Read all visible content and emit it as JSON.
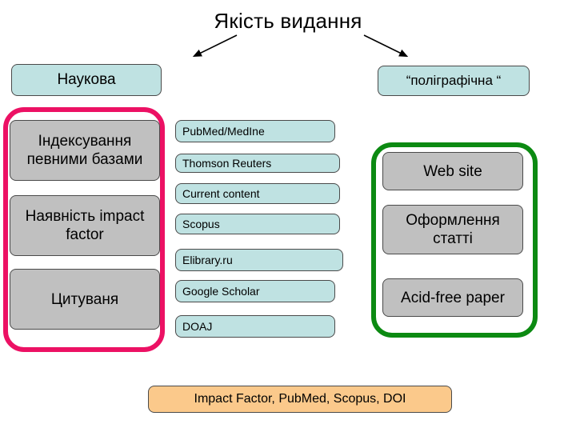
{
  "slide": {
    "title": "Якість видання",
    "background_color": "#ffffff"
  },
  "colors": {
    "cyan_box": "#bfe2e2",
    "gray_box": "#c0c0c0",
    "peach_box": "#fbc98b",
    "pink_frame": "#ec1164",
    "green_frame": "#0c8a12",
    "text": "#000000"
  },
  "branches": {
    "left": {
      "heading": "Наукова",
      "frame_color": "#ec1164",
      "items": [
        "Індексування певними базами",
        "Наявність impact factor",
        "Цитуваня"
      ]
    },
    "right": {
      "heading": "“поліграфічна “",
      "frame_color": "#0c8a12",
      "items": [
        "Web site",
        "Оформлення статті",
        "Acid-free paper"
      ]
    }
  },
  "databases": [
    "PubMed/MedIne",
    "Thomson Reuters",
    "Current content",
    "Scopus",
    "Elibrary.ru",
    "Google Scholar",
    "DOAJ"
  ],
  "footer": {
    "text": "Impact Factor, PubMed, Scopus, DOI"
  }
}
